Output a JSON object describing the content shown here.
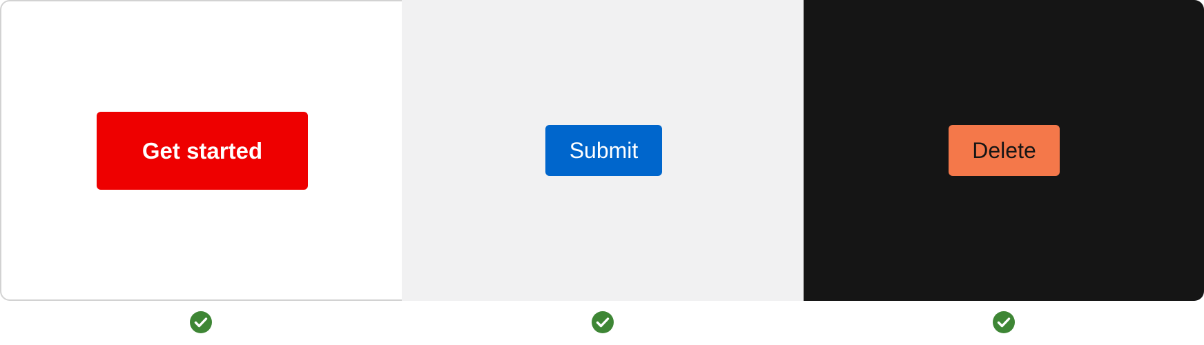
{
  "panels": [
    {
      "name": "light-background-example",
      "background_color": "#ffffff",
      "button": {
        "label": "Get started",
        "background_color": "#ee0000",
        "text_color": "#ffffff"
      }
    },
    {
      "name": "gray-background-example",
      "background_color": "#f1f1f2",
      "button": {
        "label": "Submit",
        "background_color": "#0066cc",
        "text_color": "#ffffff"
      }
    },
    {
      "name": "dark-background-example",
      "background_color": "#151515",
      "button": {
        "label": "Delete",
        "background_color": "#f4784a",
        "text_color": "#151515"
      }
    }
  ],
  "status_icons": [
    {
      "icon": "check-circle-icon",
      "status": "success",
      "color": "#3e8635"
    },
    {
      "icon": "check-circle-icon",
      "status": "success",
      "color": "#3e8635"
    },
    {
      "icon": "check-circle-icon",
      "status": "success",
      "color": "#3e8635"
    }
  ]
}
